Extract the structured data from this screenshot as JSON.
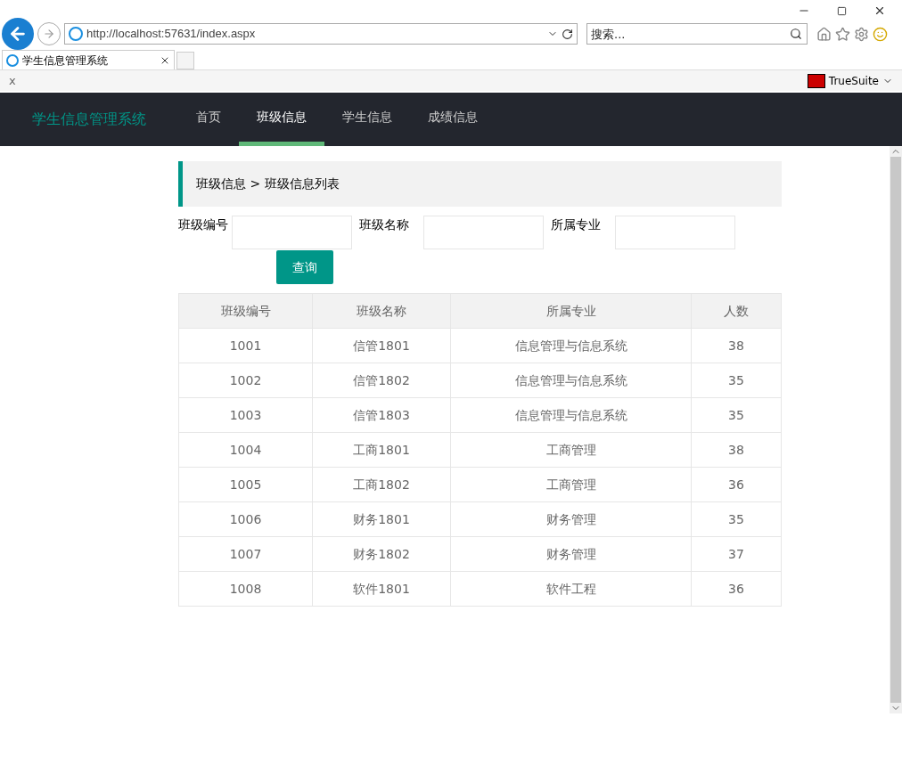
{
  "browser": {
    "address": "http://localhost:57631/index.aspx",
    "search_placeholder": "搜索...",
    "tabs": [
      {
        "title": "学生信息管理系统",
        "selected": true
      }
    ],
    "close_bar_label": "x",
    "toolbar_item": "TrueSuite"
  },
  "app": {
    "title": "学生信息管理系统",
    "nav": [
      {
        "label": "首页",
        "selected": false
      },
      {
        "label": "班级信息",
        "selected": true
      },
      {
        "label": "学生信息",
        "selected": false
      },
      {
        "label": "成绩信息",
        "selected": false
      }
    ]
  },
  "breadcrumb": "班级信息 > 班级信息列表",
  "filters": [
    {
      "label": "班级编号"
    },
    {
      "label": "班级名称"
    },
    {
      "label": "所属专业"
    }
  ],
  "query_button": "查询",
  "table": {
    "columns": [
      "班级编号",
      "班级名称",
      "所属专业",
      "人数"
    ],
    "rows": [
      [
        "1001",
        "信管1801",
        "信息管理与信息系统",
        "38"
      ],
      [
        "1002",
        "信管1802",
        "信息管理与信息系统",
        "35"
      ],
      [
        "1003",
        "信管1803",
        "信息管理与信息系统",
        "35"
      ],
      [
        "1004",
        "工商1801",
        "工商管理",
        "38"
      ],
      [
        "1005",
        "工商1802",
        "工商管理",
        "36"
      ],
      [
        "1006",
        "财务1801",
        "财务管理",
        "35"
      ],
      [
        "1007",
        "财务1802",
        "财务管理",
        "37"
      ],
      [
        "1008",
        "软件1801",
        "软件工程",
        "36"
      ]
    ]
  }
}
